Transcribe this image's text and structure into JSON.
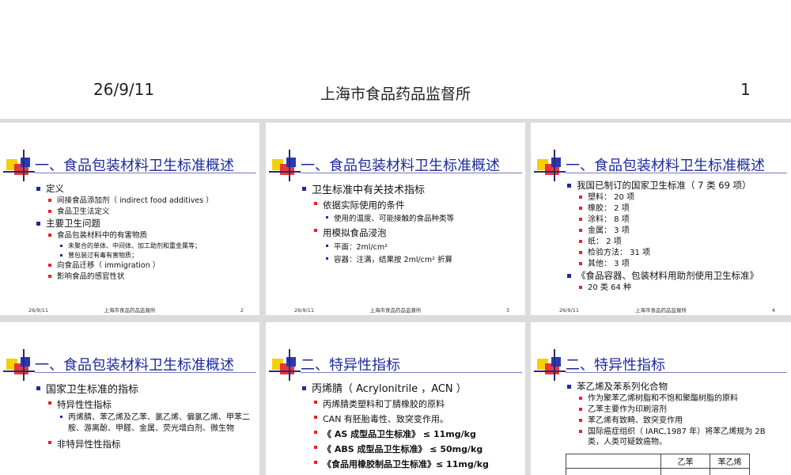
{
  "header": {
    "date": "26/9/11",
    "title": "上海市食品药品监督所",
    "page": "1"
  },
  "slides": [
    {
      "title": "一、食品包装材料卫生标准概述",
      "footer": {
        "date": "26/9/11",
        "title": "上海市食品药品监督所",
        "page": "2"
      },
      "items": {
        "a": "定义",
        "a1": "间接食品添加剂（ indirect food additives ）",
        "a2": "食品卫生法定义",
        "b": "主要卫生问题",
        "b1": "食品包装材料中的有害物质",
        "b1a": "未聚合的单体、中间体、加工助剂和重金属等；",
        "b1b": "曾包装过有毒有害物质；",
        "b2": "向食品迁移（ immigration ）",
        "b3": "影响食品的感官性状"
      }
    },
    {
      "title": "一、食品包装材料卫生标准概述",
      "footer": {
        "date": "26/9/11",
        "title": "上海市食品药品监督所",
        "page": "3"
      },
      "items": {
        "a": "卫生标准中有关技术指标",
        "a1": "依据实际使用的条件",
        "a1a": "使用的温度、可能接触的食品种类等",
        "a2": "用模拟食品浸泡",
        "a2a": "平面：2ml/cm²",
        "a2b": "容器：注满，结果按 2ml/cm² 折算"
      }
    },
    {
      "title": "一、食品包装材料卫生标准概述",
      "footer": {
        "date": "26/9/11",
        "title": "上海市食品药品监督所",
        "page": "4"
      },
      "items": {
        "a": "我国已制订的国家卫生标准（ 7 类 69 项）",
        "a1": "塑料： 20 项",
        "a2": "橡胶： 2 项",
        "a3": "涂料： 8 项",
        "a4": "金属： 3 项",
        "a5": "纸：  2 项",
        "a6": "检验方法： 31 项",
        "a7": "其他： 3 项",
        "b": "《食品容器、包装材料用助剂使用卫生标准》",
        "b1": "20 类 64 种"
      }
    },
    {
      "title": "一、食品包装材料卫生标准概述",
      "items": {
        "a": "国家卫生标准的指标",
        "a1": "特异性性指标",
        "a1a": "丙烯腈、苯乙烯及乙苯、氯乙烯、偏氯乙烯、甲苯二胺、游离酚、甲醛、金属、荧光增白剂、微生物",
        "a2": "非特异性性指标"
      }
    },
    {
      "title": "二、特异性指标",
      "items": {
        "a": "丙烯腈（ Acrylonitrile ，ACN ）",
        "a1": "丙烯腈类塑料和丁腈橡胶的原料",
        "a2": "CAN 有胚胎毒性、致突变作用。",
        "a3": "《 AS 成型品卫生标准》  ≤ 11mg/kg",
        "a4": "《 ABS 成型品卫生标准》  ≤ 50mg/kg",
        "a5": "《食品用橡胶制品卫生标准》≤ 11mg/kg"
      }
    },
    {
      "title": "二、特异性指标",
      "items": {
        "a": "苯乙烯及苯系列化合物",
        "a1": "作为聚苯乙烯树脂和不饱和聚酯树脂的原料",
        "a2": "乙苯主要作为印刷溶剂",
        "a3": "苯乙烯有致畸、致突变作用",
        "a4": "国际癌症组织（ IARC,1987 年）将苯乙烯规为 2B 类，人类可疑致癌物。"
      },
      "table": {
        "h0": "",
        "h1": "乙苯",
        "h2": "苯乙烯"
      }
    }
  ]
}
